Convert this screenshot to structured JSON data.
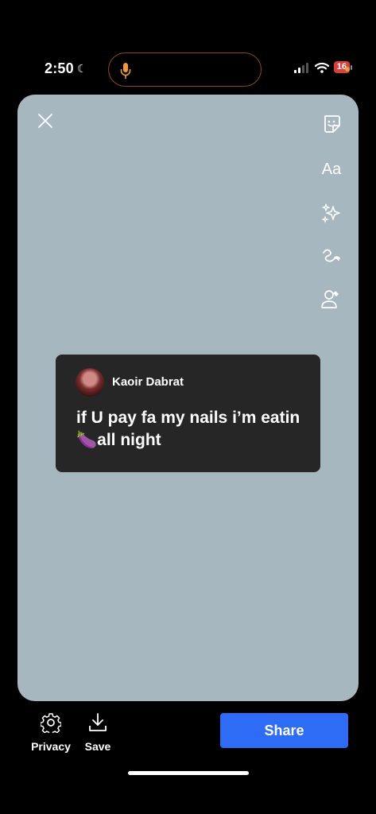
{
  "status_bar": {
    "time": "2:50",
    "battery_level": "16",
    "accent_color": "#f19a38"
  },
  "canvas": {
    "background_color": "#a7b7c0",
    "close_icon": "close-icon",
    "tools": [
      "sticker-icon",
      "text-tool",
      "effects-icon",
      "draw-icon",
      "mention-icon"
    ],
    "text_tool_label": "Aa"
  },
  "card": {
    "author": "Kaoir Dabrat",
    "text": "if U pay fa my nails i’m eatin🍆all night"
  },
  "bottom_bar": {
    "privacy_label": "Privacy",
    "save_label": "Save",
    "share_label": "Share",
    "share_color": "#2e6cf6"
  }
}
